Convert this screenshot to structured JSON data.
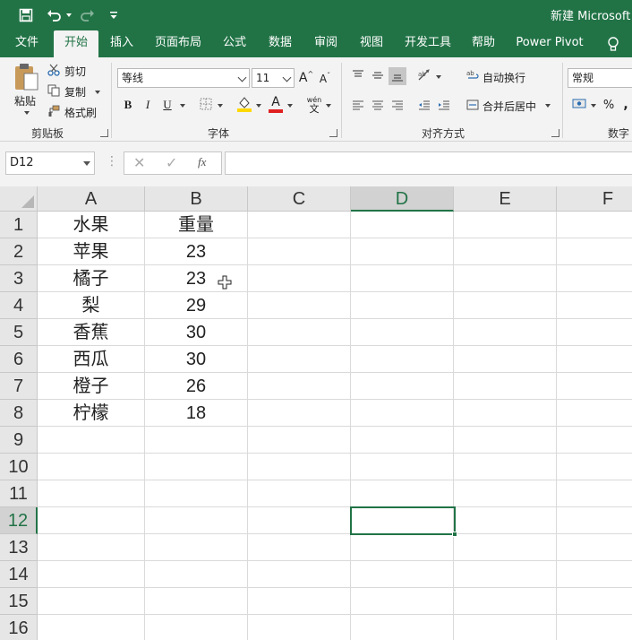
{
  "title_bar": {
    "doc_title": "新建 Microsoft E",
    "quick_access": [
      "save-icon",
      "undo-icon",
      "redo-icon",
      "customize-qat-icon"
    ]
  },
  "ribbon_tabs": [
    "文件",
    "开始",
    "插入",
    "页面布局",
    "公式",
    "数据",
    "审阅",
    "视图",
    "开发工具",
    "帮助",
    "Power Pivot"
  ],
  "active_tab": "开始",
  "ribbon": {
    "clipboard": {
      "paste": "粘贴",
      "cut": "剪切",
      "copy": "复制",
      "format_painter": "格式刷",
      "group_label": "剪贴板"
    },
    "font": {
      "font_name": "等线",
      "font_size": "11",
      "bold": "B",
      "italic": "I",
      "underline": "U",
      "grow": "A",
      "shrink": "A",
      "font_color_letter": "A",
      "phonetic_top": "wén",
      "phonetic_bottom": "文",
      "group_label": "字体"
    },
    "alignment": {
      "wrap_text": "自动换行",
      "merge_center": "合并后居中",
      "group_label": "对齐方式"
    },
    "number": {
      "format": "常规",
      "percent": "%",
      "comma": ",",
      "group_label": "数字"
    }
  },
  "formula_bar": {
    "name_box": "D12",
    "fx": "fx",
    "formula_value": ""
  },
  "sheet": {
    "columns": [
      "A",
      "B",
      "C",
      "D",
      "E",
      "F"
    ],
    "rows": [
      "1",
      "2",
      "3",
      "4",
      "5",
      "6",
      "7",
      "8",
      "9",
      "10",
      "11",
      "12",
      "13",
      "14",
      "15",
      "16"
    ],
    "data": [
      [
        "水果",
        "重量"
      ],
      [
        "苹果",
        "23"
      ],
      [
        "橘子",
        "23"
      ],
      [
        "梨",
        "29"
      ],
      [
        "香蕉",
        "30"
      ],
      [
        "西瓜",
        "30"
      ],
      [
        "橙子",
        "26"
      ],
      [
        "柠檬",
        "18"
      ]
    ],
    "selected_cell": "D12",
    "selected_column": "D",
    "selected_row": "12"
  },
  "colors": {
    "brand": "#217346",
    "ribbon_bg": "#f3f3f3",
    "header_bg": "#e6e6e6",
    "gridline": "#dadada"
  }
}
